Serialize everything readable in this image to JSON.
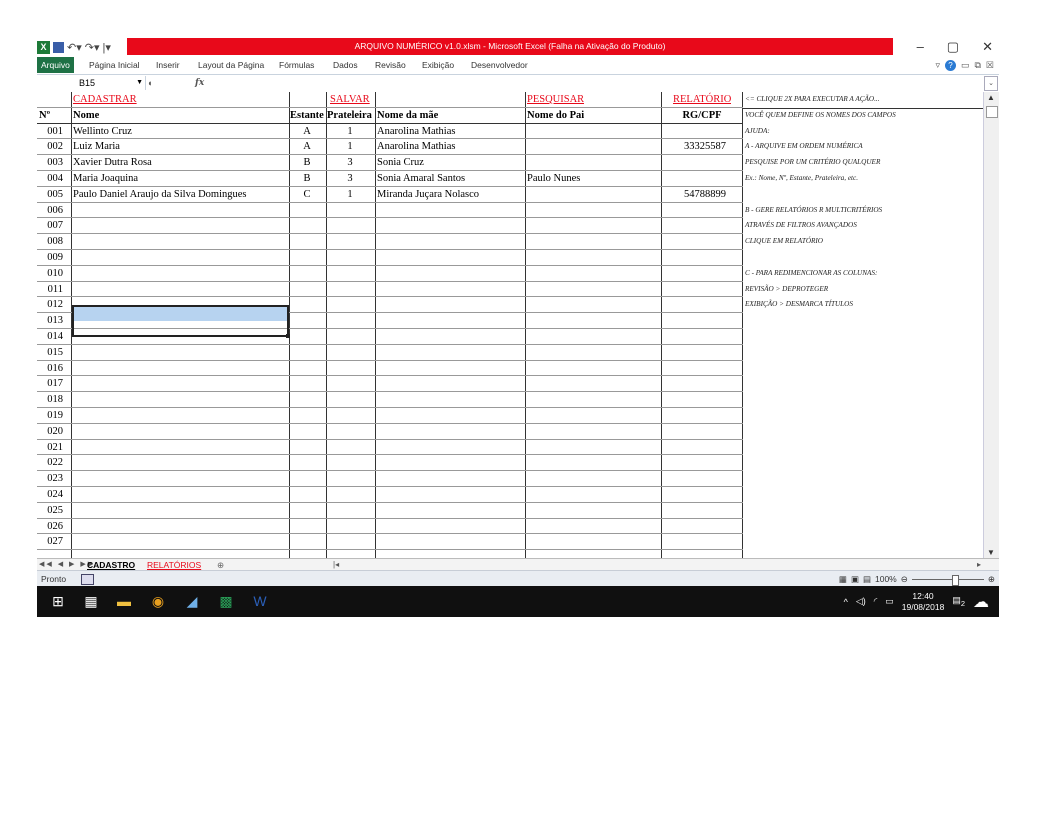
{
  "window": {
    "title": "ARQUIVO NUMÉRICO v1.0.xlsm  -  Microsoft Excel (Falha na Ativação do Produto)",
    "controls": [
      "–",
      "▢",
      "✕"
    ]
  },
  "ribbon": {
    "file_tab": "Arquivo",
    "tabs": [
      "Página Inicial",
      "Inserir",
      "Layout da Página",
      "Fórmulas",
      "Dados",
      "Revisão",
      "Exibição",
      "Desenvolvedor"
    ]
  },
  "formula_bar": {
    "name_box": "B15",
    "fx": "fx",
    "value": ""
  },
  "sheet": {
    "actions": {
      "cadastrar": "CADASTRAR",
      "salvar": "SALVAR",
      "pesquisar": "PESQUISAR",
      "relatorio": "RELATÓRIO"
    },
    "headers": [
      "Nº",
      "Nome",
      "Estante",
      "Prateleira",
      "Nome da mãe",
      "Nome do Pai",
      "RG/CPF"
    ],
    "rows": [
      [
        "001",
        "Wellinto Cruz",
        "A",
        "1",
        "Anarolina Mathias",
        "",
        ""
      ],
      [
        "002",
        "Luiz Maria",
        "A",
        "1",
        "Anarolina Mathias",
        "",
        "33325587"
      ],
      [
        "003",
        "Xavier Dutra Rosa",
        "B",
        "3",
        "Sonia Cruz",
        "",
        ""
      ],
      [
        "004",
        "Maria Joaquina",
        "B",
        "3",
        "Sonia Amaral Santos",
        "Paulo Nunes",
        ""
      ],
      [
        "005",
        "Paulo Daniel Araujo da Silva Domingues",
        "C",
        "1",
        "Miranda Juçara Nolasco",
        "",
        "54788899"
      ],
      [
        "006",
        "",
        "",
        "",
        "",
        "",
        ""
      ],
      [
        "007",
        "",
        "",
        "",
        "",
        "",
        ""
      ],
      [
        "008",
        "",
        "",
        "",
        "",
        "",
        ""
      ],
      [
        "009",
        "",
        "",
        "",
        "",
        "",
        ""
      ],
      [
        "010",
        "",
        "",
        "",
        "",
        "",
        ""
      ],
      [
        "011",
        "",
        "",
        "",
        "",
        "",
        ""
      ],
      [
        "012",
        "",
        "",
        "",
        "",
        "",
        ""
      ],
      [
        "013",
        "",
        "",
        "",
        "",
        "",
        ""
      ],
      [
        "014",
        "",
        "",
        "",
        "",
        "",
        ""
      ],
      [
        "015",
        "",
        "",
        "",
        "",
        "",
        ""
      ],
      [
        "016",
        "",
        "",
        "",
        "",
        "",
        ""
      ],
      [
        "017",
        "",
        "",
        "",
        "",
        "",
        ""
      ],
      [
        "018",
        "",
        "",
        "",
        "",
        "",
        ""
      ],
      [
        "019",
        "",
        "",
        "",
        "",
        "",
        ""
      ],
      [
        "020",
        "",
        "",
        "",
        "",
        "",
        ""
      ],
      [
        "021",
        "",
        "",
        "",
        "",
        "",
        ""
      ],
      [
        "022",
        "",
        "",
        "",
        "",
        "",
        ""
      ],
      [
        "023",
        "",
        "",
        "",
        "",
        "",
        ""
      ],
      [
        "024",
        "",
        "",
        "",
        "",
        "",
        ""
      ],
      [
        "025",
        "",
        "",
        "",
        "",
        "",
        ""
      ],
      [
        "026",
        "",
        "",
        "",
        "",
        "",
        ""
      ],
      [
        "027",
        "",
        "",
        "",
        "",
        "",
        ""
      ]
    ],
    "help_lines": [
      "<= CLIQUE 2X PARA EXECUTAR A AÇÃO...",
      "VOCÊ  QUEM DEFINE OS NOMES DOS CAMPOS",
      "AJUDA:",
      "A - ARQUIVE EM ORDEM NUMÉRICA",
      "PESQUISE POR UM CRITÉRIO QUALQUER",
      "Ex.: Nome, Nº, Estante, Prateleira, etc.",
      "",
      "B - GERE RELATÓRIOS R MULTICRITÉRIOS",
      "ATRAVÉS DE FILTROS AVANÇADOS",
      "CLIQUE EM RELATÓRIO",
      "",
      " C - PARA REDIMENCIONAR AS COLUNAS:",
      "REVISÃO > DEPROTEGER",
      "EXIBIÇÃO > DESMARCA TÍTULOS"
    ]
  },
  "sheet_tabs": [
    "CADASTRO",
    "RELATÓRIOS"
  ],
  "status": {
    "ready": "Pronto",
    "zoom": "100%"
  },
  "taskbar": {
    "time": "12:40",
    "date": "19/08/2018",
    "notifications": "2",
    "colors": {
      "background": "#101010",
      "accent": "#e8091a",
      "excel": "#1e7145"
    }
  }
}
